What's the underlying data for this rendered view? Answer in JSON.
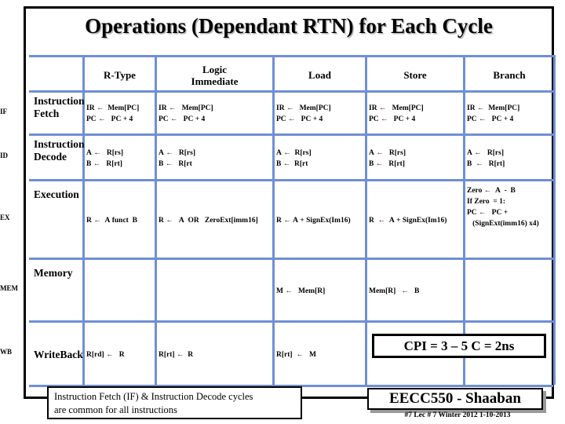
{
  "slide": {
    "title": "Operations (Dependant RTN) for Each Cycle",
    "accent_color": "#6f8fd6",
    "frame_color": "#000000"
  },
  "table": {
    "corner_header": "",
    "columns": [
      {
        "label": "R-Type"
      },
      {
        "label": "Logic\nImmediate"
      },
      {
        "label": "Load"
      },
      {
        "label": "Store"
      },
      {
        "label": "Branch"
      }
    ],
    "rows": [
      {
        "abbr": "IF",
        "name": "Instruction Fetch",
        "cells": [
          {
            "lines": [
              "IR ←  Mem[PC]",
              "PC ←   PC + 4"
            ]
          },
          {
            "lines": [
              "IR ←   Mem[PC]",
              "PC ←   PC + 4"
            ]
          },
          {
            "lines": [
              "IR ←   Mem[PC]",
              "PC ←   PC + 4"
            ]
          },
          {
            "lines": [
              "IR ←   Mem[PC]",
              "PC ←   PC + 4"
            ]
          },
          {
            "lines": [
              "IR ←  Mem[PC]",
              "PC ←   PC + 4"
            ]
          }
        ]
      },
      {
        "abbr": "ID",
        "name": "Instruction Decode",
        "cells": [
          {
            "lines": [
              "A ←   R[rs]",
              "B ←   R[rt]"
            ]
          },
          {
            "lines": [
              "A ←   R[rs]",
              "B ←   R[rt"
            ]
          },
          {
            "lines": [
              "A ←  R[rs]",
              "B ←  R[rt"
            ]
          },
          {
            "lines": [
              "A ←   R[rs]",
              "B ←   R[rt]"
            ]
          },
          {
            "lines": [
              "A ←   R[rs]",
              "B  ←   R[rt]"
            ]
          }
        ]
      },
      {
        "abbr": "EX",
        "name": "Execution",
        "cells": [
          {
            "lines": [
              "R ←  A funct  B"
            ]
          },
          {
            "lines": [
              "R ←   A  OR   ZeroExt[imm16]"
            ]
          },
          {
            "lines": [
              "R ← A + SignEx(Im16)"
            ]
          },
          {
            "lines": [
              "R  ←  A + SignEx(Im16)"
            ]
          },
          {
            "lines": [
              "Zero ←  A  -  B",
              "If Zero  = 1:",
              "PC ←   PC +",
              "   (SignExt(imm16) x4)"
            ]
          }
        ]
      },
      {
        "abbr": "MEM",
        "name": "Memory",
        "cells": [
          {
            "lines": []
          },
          {
            "lines": []
          },
          {
            "lines": [
              "M ←   Mem[R]"
            ]
          },
          {
            "lines": [
              "Mem[R]   ←   B"
            ]
          },
          {
            "lines": []
          }
        ]
      },
      {
        "abbr": "WB",
        "name": "Write Back",
        "cells": [
          {
            "lines": [
              "R[rd] ←   R"
            ]
          },
          {
            "lines": [
              "R[rt] ←  R"
            ]
          },
          {
            "lines": [
              "R[rt]  ←   M"
            ]
          },
          {
            "lines": []
          },
          {
            "lines": []
          }
        ]
      }
    ]
  },
  "cpi_box": {
    "text": "CPI = 3 – 5   C = 2ns"
  },
  "note_box": {
    "line1": "Instruction Fetch (IF) & Instruction Decode cycles",
    "line2": "are common for all instructions"
  },
  "footer": {
    "badge": "EECC550 - Shaaban",
    "meta": "#7   Lec # 7  Winter 2012  1-10-2013"
  }
}
